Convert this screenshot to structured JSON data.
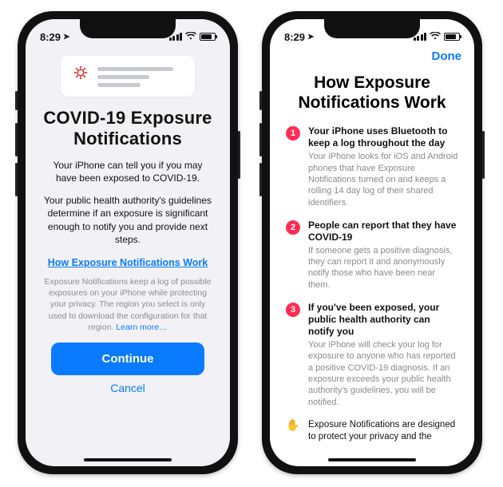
{
  "status": {
    "time": "8:29",
    "location_icon": "➤"
  },
  "phone1": {
    "title": "COVID-19 Exposure Notifications",
    "para1": "Your iPhone can tell you if you may have been exposed to COVID-19.",
    "para2": "Your public health authority's guidelines determine if an exposure is significant enough to notify you and provide next steps.",
    "how_link": "How Exposure Notifications Work",
    "fineprint": "Exposure Notifications keep a log of possible exposures on your iPhone while protecting your privacy. The region you select is only used to download the configuration for that region.",
    "learn_more": "Learn more…",
    "continue": "Continue",
    "cancel": "Cancel"
  },
  "phone2": {
    "done": "Done",
    "title": "How Exposure Notifications Work",
    "steps": [
      {
        "num": "1",
        "title": "Your iPhone uses Bluetooth to keep a log throughout the day",
        "body": "Your iPhone looks for iOS and Android phones that have Exposure Notifications turned on and keeps a rolling 14 day log of their shared identifiers."
      },
      {
        "num": "2",
        "title": "People can report that they have COVID-19",
        "body": "If someone gets a positive diagnosis, they can report it and anonymously notify those who have been near them."
      },
      {
        "num": "3",
        "title": "If you've been exposed, your public health authority can notify you",
        "body": "Your iPhone will check your log for exposure to anyone who has reported a positive COVID-19 diagnosis. If an exposure exceeds your public health authority's guidelines, you will be notified."
      }
    ],
    "privacy_line": "Exposure Notifications are designed to protect your privacy and the"
  }
}
